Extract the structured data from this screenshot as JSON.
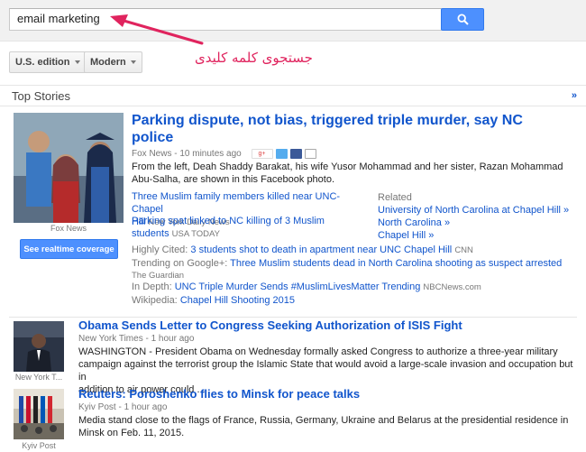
{
  "search": {
    "query": "email marketing"
  },
  "annotation": "جستجوی کلمه کلیدی",
  "controls": {
    "edition": "U.S. edition",
    "style": "Modern"
  },
  "section": {
    "title": "Top Stories",
    "expand": "»"
  },
  "lead": {
    "image_credit": "Fox News",
    "realtime_button": "See realtime coverage",
    "headline_line1": "Parking dispute, not bias, triggered triple murder, say NC",
    "headline_line2": "police",
    "source_time": "Fox News - 10 minutes ago",
    "snippet_line1": "From the left, Deah Shaddy Barakat, his wife Yusor Mohammad and her sister, Razan Mohammad",
    "snippet_line2": "Abu-Salha, are shown in this Facebook photo.",
    "sub1_line1": "Three Muslim family members killed near UNC-Chapel",
    "sub1_line2": "Hill",
    "sub1_source": "New York Daily News",
    "sub2_line1": "Parking spat linked to NC killing of 3 Muslim",
    "sub2_line2": "students",
    "sub2_source": "USA TODAY",
    "related_label": "Related",
    "related": [
      "University of North Carolina at Chapel Hill »",
      "North Carolina »",
      "Chapel Hill »"
    ],
    "highly_cited_label": "Highly Cited:",
    "highly_cited_text": "3 students shot to death in apartment near UNC Chapel Hill",
    "highly_cited_source": "CNN",
    "trending_label": "Trending on Google+:",
    "trending_text": "Three Muslim students dead in North Carolina shooting as suspect arrested",
    "trending_source": "The Guardian",
    "indepth_label": "In Depth:",
    "indepth_text": "UNC Triple Murder Sends #MuslimLivesMatter Trending",
    "indepth_source": "NBCNews.com",
    "wiki_label": "Wikipedia:",
    "wiki_text": "Chapel Hill Shooting 2015"
  },
  "story2": {
    "headline": "Obama Sends Letter to Congress Seeking Authorization of ISIS Fight",
    "source_time": "New York Times - 1 hour ago",
    "snippet_line1": "WASHINGTON - President Obama on Wednesday formally asked Congress to authorize a three-year military",
    "snippet_line2": "campaign against the terrorist group the Islamic State that would avoid a large-scale invasion and occupation but in",
    "snippet_line3": "addition to air power could ...",
    "image_credit": "New York T..."
  },
  "story3": {
    "headline": "Reuters: Poroshenko flies to Minsk for peace talks",
    "source_time": "Kyiv Post - 1 hour ago",
    "snippet_line1": "Media stand close to the flags of France, Russia, Germany, Ukraine and Belarus at the presidential residence in",
    "snippet_line2": "Minsk on Feb. 11, 2015.",
    "image_credit": "Kyiv Post"
  },
  "colors": {
    "accent": "#4d90fe",
    "link": "#1155cc",
    "annotation": "#e0245e"
  }
}
